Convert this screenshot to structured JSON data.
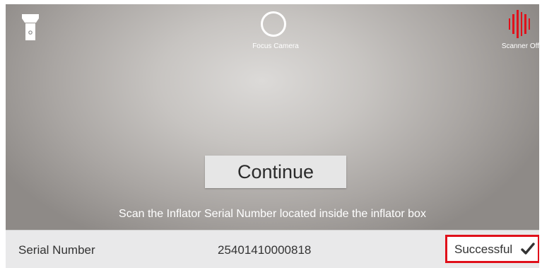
{
  "toolbar": {
    "flash_icon": "flashlight-icon",
    "focus_label": "Focus Camera",
    "scanner_label": "Scanner Off",
    "scanner_icon": "barcode-scanner-icon"
  },
  "main": {
    "continue_label": "Continue",
    "instruction": "Scan the Inflator Serial Number located inside the inflator box"
  },
  "result": {
    "serial_label": "Serial Number",
    "serial_value": "25401410000818",
    "status": "Successful",
    "status_icon": "checkmark-icon"
  },
  "colors": {
    "scanner_red": "#e0101a",
    "highlight_red": "#e0101a",
    "bar_bg": "#e9e9ea"
  }
}
